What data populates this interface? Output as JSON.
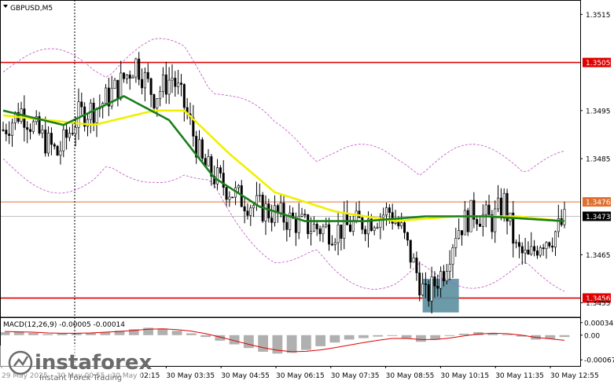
{
  "chart_data": [
    {
      "type": "candlestick",
      "title": "GBPUSD,M5",
      "ylim": [
        1.3452,
        1.3518
      ],
      "y_ticks": [
        "1.3515",
        "1.3505",
        "1.3495",
        "1.3485",
        "1.3476",
        "1.3473",
        "1.3465",
        "1.3456",
        "1.3455"
      ],
      "x_labels": [
        "29 May 2025",
        "30 May 00:55",
        "30 May 02:15",
        "30 May 03:35",
        "30 May 04:55",
        "30 May 06:15",
        "30 May 07:35",
        "30 May 08:55",
        "30 May 10:15",
        "30 May 11:35",
        "30 May 12:55"
      ],
      "levels": [
        {
          "label": "1.3505",
          "value": 1.3505,
          "color": "#e00000"
        },
        {
          "label": "1.3476",
          "value": 1.3476,
          "color": "#e07030"
        },
        {
          "label": "1.3456",
          "value": 1.3456,
          "color": "#e00000"
        }
      ],
      "current_price": {
        "label": "1.3473",
        "value": 1.3473
      },
      "candle_close_path": [
        [
          0,
          1.3491
        ],
        [
          6,
          1.3495
        ],
        [
          12,
          1.349
        ],
        [
          18,
          1.3486
        ],
        [
          25,
          1.3494
        ],
        [
          32,
          1.3496
        ],
        [
          38,
          1.35
        ],
        [
          44,
          1.3505
        ],
        [
          50,
          1.3498
        ],
        [
          56,
          1.3502
        ],
        [
          60,
          1.3496
        ],
        [
          66,
          1.3484
        ],
        [
          72,
          1.348
        ],
        [
          78,
          1.3477
        ],
        [
          84,
          1.3475
        ],
        [
          92,
          1.3473
        ],
        [
          100,
          1.3471
        ],
        [
          110,
          1.347
        ],
        [
          120,
          1.3472
        ],
        [
          128,
          1.3474
        ],
        [
          132,
          1.347
        ],
        [
          136,
          1.3463
        ],
        [
          140,
          1.3456
        ],
        [
          146,
          1.3462
        ],
        [
          150,
          1.347
        ],
        [
          156,
          1.3474
        ],
        [
          162,
          1.3472
        ],
        [
          166,
          1.3476
        ],
        [
          170,
          1.3466
        ],
        [
          174,
          1.3464
        ],
        [
          178,
          1.3468
        ],
        [
          182,
          1.3469
        ],
        [
          186,
          1.3472
        ]
      ],
      "ma_green": {
        "color": "#1a7f1a",
        "values": [
          [
            0,
            1.3495
          ],
          [
            20,
            1.3492
          ],
          [
            40,
            1.3498
          ],
          [
            55,
            1.3493
          ],
          [
            70,
            1.3481
          ],
          [
            85,
            1.3475
          ],
          [
            100,
            1.3472
          ],
          [
            120,
            1.3472
          ],
          [
            140,
            1.3473
          ],
          [
            160,
            1.3473
          ],
          [
            186,
            1.3472
          ]
        ]
      },
      "ma_yellow": {
        "color": "#f0f000",
        "values": [
          [
            0,
            1.3494
          ],
          [
            30,
            1.3492
          ],
          [
            50,
            1.3495
          ],
          [
            60,
            1.3495
          ],
          [
            75,
            1.3486
          ],
          [
            90,
            1.3478
          ],
          [
            110,
            1.3474
          ],
          [
            130,
            1.3472
          ],
          [
            150,
            1.3473
          ],
          [
            170,
            1.3473
          ],
          [
            186,
            1.3472
          ]
        ]
      },
      "bands_color": "#c050c0",
      "highlight_box": {
        "x_from": 139,
        "x_to": 151,
        "y_from": 1.3453,
        "y_to": 1.346,
        "color": "#5b8f9e"
      }
    },
    {
      "type": "histogram",
      "title": "MACD(12,26,9) -0.00005 -0.00014",
      "ylim": [
        -0.00075,
        0.0004
      ],
      "y_ticks": [
        "0.00034",
        "0.00",
        "-0.00067"
      ],
      "signal_color": "#e00000",
      "histogram": [
        8e-05,
        0.0001,
        6e-05,
        3e-05,
        4e-05,
        5e-05,
        6e-05,
        8e-05,
        0.00012,
        0.00016,
        0.0002,
        0.00018,
        0.00012,
        5e-05,
        -5e-05,
        -0.00015,
        -0.00025,
        -0.00035,
        -0.00045,
        -0.0005,
        -0.00048,
        -0.0004,
        -0.0003,
        -0.0002,
        -0.00012,
        -8e-05,
        -4e-05,
        -2e-05,
        -8e-05,
        -0.00018,
        -0.00012,
        -2e-05,
        4e-05,
        8e-05,
        6e-05,
        2e-05,
        -4e-05,
        -0.00012,
        -0.0001,
        -5e-05
      ],
      "signal": [
        0.0001,
        9e-05,
        8e-05,
        6e-05,
        5e-05,
        5e-05,
        6e-05,
        8e-05,
        0.0001,
        0.00013,
        0.00016,
        0.00017,
        0.00015,
        0.00011,
        4e-05,
        -5e-05,
        -0.00015,
        -0.00025,
        -0.00034,
        -0.00041,
        -0.00045,
        -0.00044,
        -0.0004,
        -0.00034,
        -0.00027,
        -0.0002,
        -0.00014,
        -9e-05,
        -9e-05,
        -0.00012,
        -0.00012,
        -8e-05,
        -2e-05,
        3e-05,
        5e-05,
        4e-05,
        0.0,
        -6e-05,
        -0.0001,
        -0.00014
      ]
    }
  ],
  "watermark": {
    "brand": "instaforex",
    "tagline": "Instant Forex Trading"
  },
  "icons": {
    "dropdown": "triangle-down-icon"
  }
}
